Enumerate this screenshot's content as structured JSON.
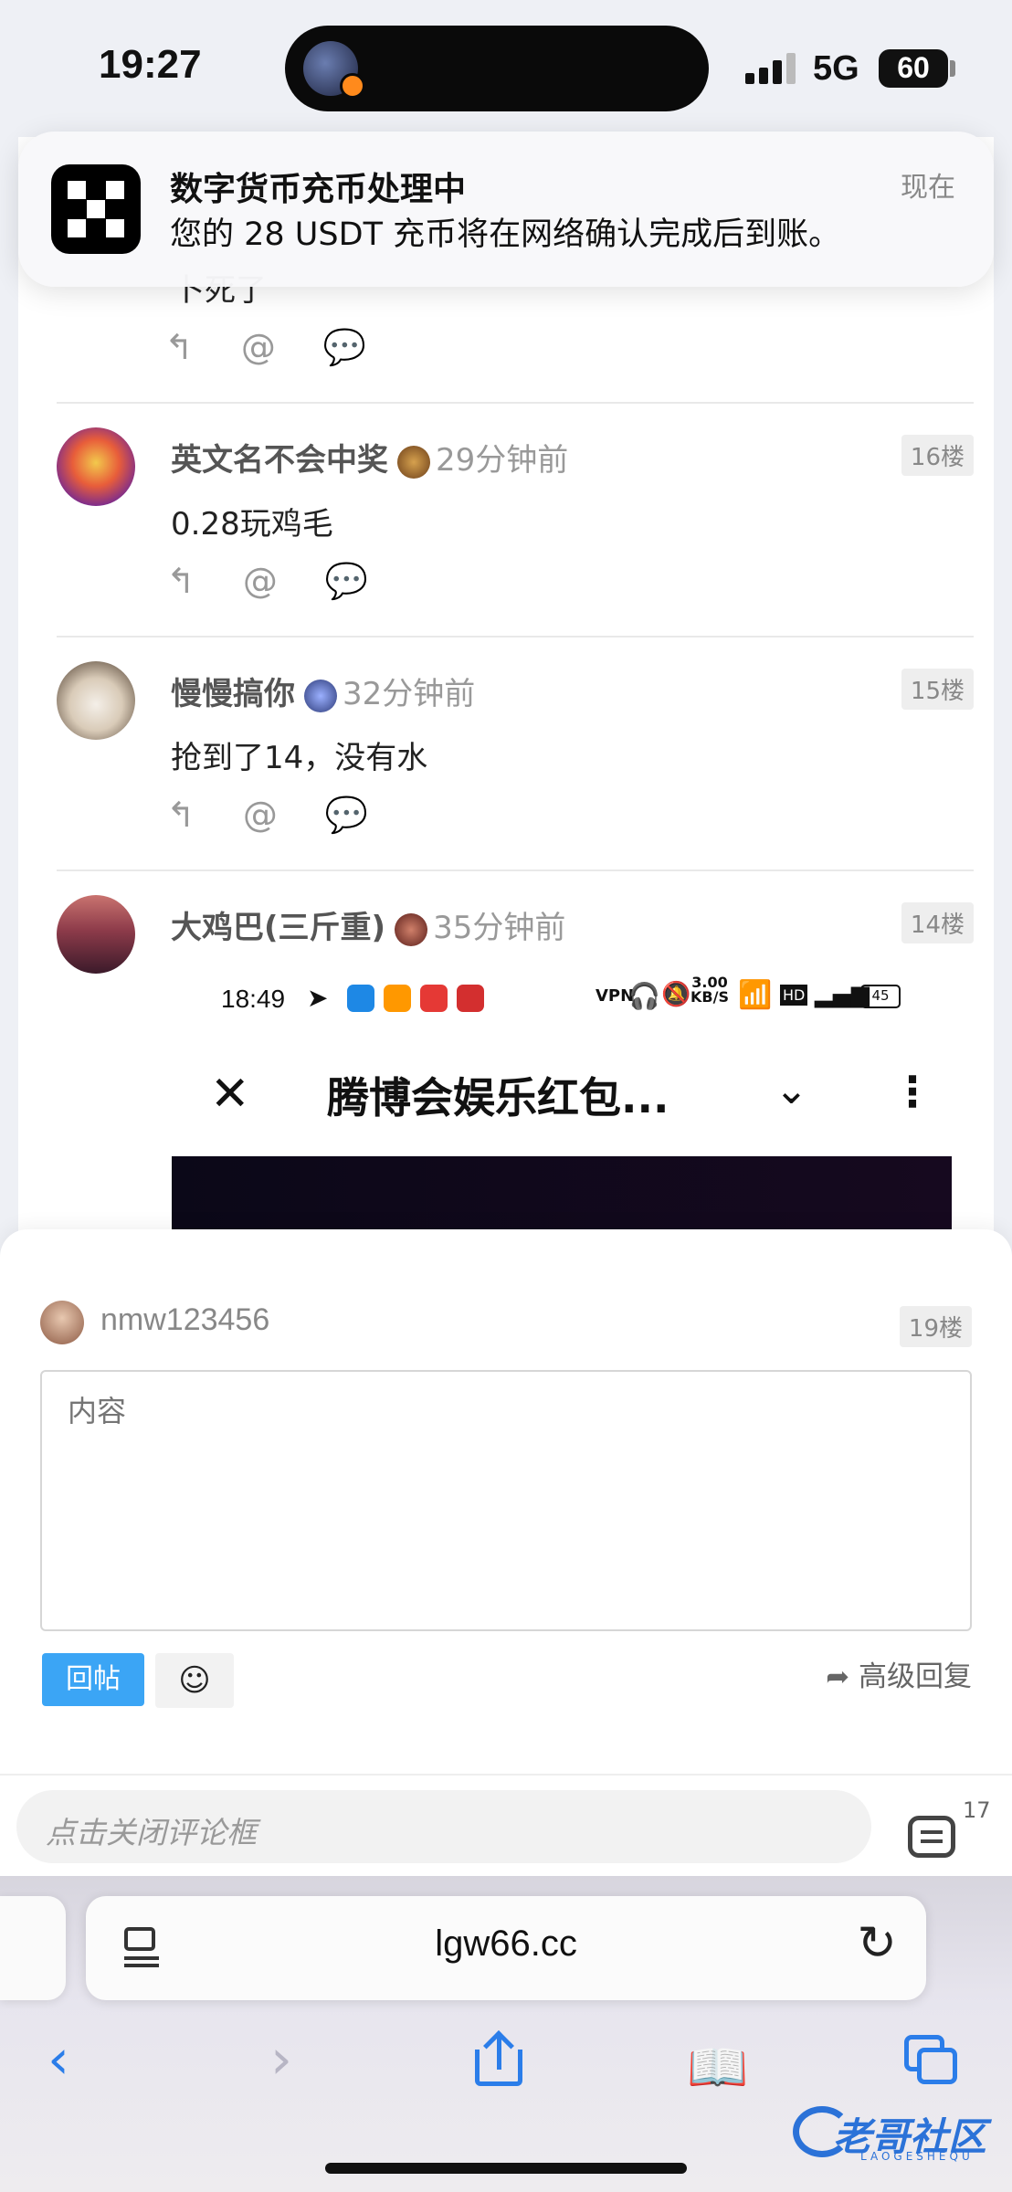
{
  "status_bar": {
    "time": "19:27",
    "network": "5G",
    "battery": "60"
  },
  "notification": {
    "app_icon": "okx-logo-icon",
    "title": "数字货币充币处理中",
    "body": "您的 28 USDT 充币将在网络确认完成后到账。",
    "time": "现在"
  },
  "thread": {
    "partial_text": "卜死了",
    "posts": [
      {
        "username": "英文名不会中奖",
        "time": "29分钟前",
        "floor": "16楼",
        "content": "0.28玩鸡毛"
      },
      {
        "username": "慢慢搞你",
        "time": "32分钟前",
        "floor": "15楼",
        "content": "抢到了14，没有水"
      },
      {
        "username": "大鸡巴(三斤重)",
        "time": "35分钟前",
        "floor": "14楼",
        "content": ""
      }
    ],
    "embedded": {
      "time": "18:49",
      "speed_value": "3.00",
      "speed_unit": "KB/S",
      "battery": "45",
      "title": "腾博会娱乐红包..."
    }
  },
  "reply_panel": {
    "username": "nmw123456",
    "floor": "19楼",
    "placeholder": "内容",
    "submit_label": "回帖",
    "advanced_label": "高级回复"
  },
  "bottom_bar": {
    "close_label": "点击关闭评论框",
    "comment_count": "17"
  },
  "safari": {
    "url": "lgw66.cc"
  },
  "watermark": {
    "text": "老哥社区",
    "sub": "LAOGESHEQU"
  }
}
